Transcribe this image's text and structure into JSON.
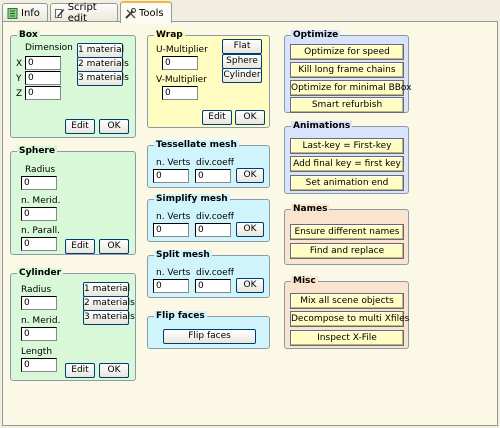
{
  "tabs": [
    {
      "label": "Info",
      "icon": "info-icon"
    },
    {
      "label": "Script edit",
      "icon": "script-edit-icon"
    },
    {
      "label": "Tools",
      "icon": "tools-icon"
    }
  ],
  "box": {
    "title": "Box",
    "dimension_label": "Dimension",
    "x_label": "X",
    "y_label": "Y",
    "z_label": "Z",
    "x_value": "0",
    "y_value": "0",
    "z_value": "0",
    "mat1": "1 material",
    "mat2": "2 materials",
    "mat3": "3 materials",
    "edit": "Edit",
    "ok": "OK"
  },
  "sphere": {
    "title": "Sphere",
    "radius_label": "Radius",
    "radius_value": "0",
    "merid_label": "n. Merid.",
    "merid_value": "0",
    "parall_label": "n. Parall.",
    "parall_value": "0",
    "edit": "Edit",
    "ok": "OK"
  },
  "cylinder": {
    "title": "Cylinder",
    "radius_label": "Radius",
    "radius_value": "0",
    "merid_label": "n. Merid.",
    "merid_value": "0",
    "length_label": "Length",
    "length_value": "0",
    "mat1": "1 material",
    "mat2": "2 materials",
    "mat3": "3 materials",
    "edit": "Edit",
    "ok": "OK"
  },
  "wrap": {
    "title": "Wrap",
    "u_label": "U-Multiplier",
    "u_value": "0",
    "v_label": "V-Multiplier",
    "v_value": "0",
    "flat": "Flat",
    "sphere": "Sphere",
    "cylinder": "Cylinder",
    "edit": "Edit",
    "ok": "OK"
  },
  "tessellate": {
    "title": "Tessellate mesh",
    "verts_label": "n. Verts",
    "verts_value": "0",
    "div_label": "div.coeff",
    "div_value": "0",
    "ok": "OK"
  },
  "simplify": {
    "title": "Simplify mesh",
    "verts_label": "n. Verts",
    "verts_value": "0",
    "div_label": "div.coeff",
    "div_value": "0",
    "ok": "OK"
  },
  "split": {
    "title": "Split mesh",
    "verts_label": "n. Verts",
    "verts_value": "0",
    "div_label": "div.coeff",
    "div_value": "0",
    "ok": "OK"
  },
  "flip": {
    "title": "Flip faces",
    "button": "Flip faces"
  },
  "optimize": {
    "title": "Optimize",
    "b1": "Optimize for speed",
    "b2": "Kill long frame chains",
    "b3": "Optimize for minimal BBox",
    "b4": "Smart refurbish"
  },
  "animations": {
    "title": "Animations",
    "b1": "Last-key = First-key",
    "b2": "Add final key = first key",
    "b3": "Set animation end"
  },
  "names": {
    "title": "Names",
    "b1": "Ensure different names",
    "b2": "Find and replace"
  },
  "misc": {
    "title": "Misc",
    "b1": "Mix all scene objects",
    "b2": "Decompose to multi Xfiles",
    "b3": "Inspect X-File"
  },
  "colors": {
    "green": "#d8f8d8",
    "yellow": "#fffcc2",
    "cyan": "#cff4fb",
    "blue": "#d9e3fb",
    "orange": "#fbe4cf",
    "active_tab": "#f3b74a"
  }
}
